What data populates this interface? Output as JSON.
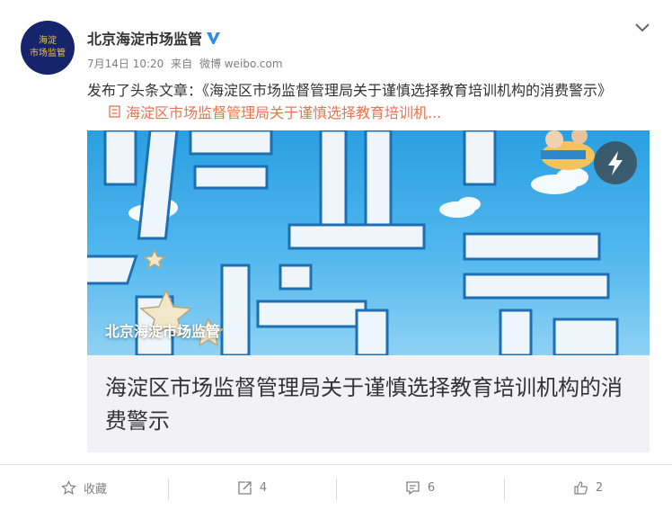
{
  "post": {
    "avatar_line1": "海淀",
    "avatar_line2": "市场监管",
    "author": "北京海淀市场监管",
    "time": "7月14日 10:20",
    "source_prefix": "来自",
    "source": "微博 weibo.com",
    "text": "发布了头条文章：《海淀区市场监督管理局关于谨慎选择教育培训机构的消费警示》",
    "link_text": "海淀区市场监督管理局关于谨慎选择教育培训机...",
    "link_icon": "article-icon",
    "menu_icon": "chevron-down-icon",
    "verified_icon": "verified-badge-icon"
  },
  "card": {
    "banner_watermark": "北京海淀市场监管",
    "banner_icon": "lightning-icon",
    "title": "海淀区市场监督管理局关于谨慎选择教育培训机构的消费警示"
  },
  "actions": {
    "favorite_label": "收藏",
    "forward_count": "4",
    "comment_count": "6",
    "like_count": "2"
  },
  "colors": {
    "link": "#eb7350",
    "verified": "#2d8ce6",
    "avatar_bg": "#16246b",
    "avatar_text": "#f2c04a",
    "card_bg": "#f2f2f5"
  }
}
